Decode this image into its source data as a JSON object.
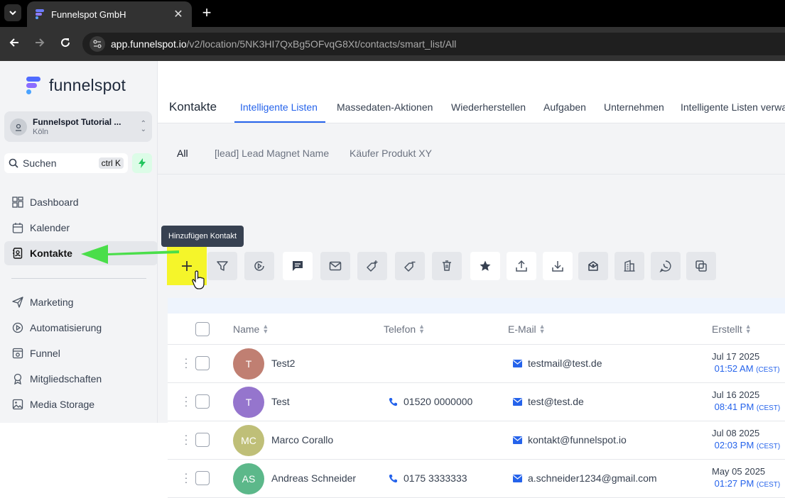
{
  "browser": {
    "tab_title": "Funnelspot GmbH",
    "url_host": "app.funnelspot.io",
    "url_path": "/v2/location/5NK3HI7QxBg5OFvqG8Xt/contacts/smart_list/All"
  },
  "sidebar": {
    "logo_text": "funnelspot",
    "account_name": "Funnelspot Tutorial ...",
    "account_location": "Köln",
    "search_label": "Suchen",
    "search_shortcut": "ctrl K",
    "items": [
      {
        "label": "Dashboard",
        "icon": "dashboard-icon"
      },
      {
        "label": "Kalender",
        "icon": "calendar-icon"
      },
      {
        "label": "Kontakte",
        "icon": "contacts-icon",
        "active": true
      },
      {
        "label": "Marketing",
        "icon": "send-icon"
      },
      {
        "label": "Automatisierung",
        "icon": "automation-icon"
      },
      {
        "label": "Funnel",
        "icon": "funnel-page-icon"
      },
      {
        "label": "Mitgliedschaften",
        "icon": "membership-icon"
      },
      {
        "label": "Media Storage",
        "icon": "image-icon"
      }
    ]
  },
  "header": {
    "title": "Kontakte",
    "tabs": [
      {
        "label": "Intelligente Listen",
        "active": true
      },
      {
        "label": "Massedaten-Aktionen"
      },
      {
        "label": "Wiederherstellen"
      },
      {
        "label": "Aufgaben"
      },
      {
        "label": "Unternehmen"
      },
      {
        "label": "Intelligente Listen verwa"
      }
    ]
  },
  "smart_lists": {
    "tabs": [
      "All",
      "[lead] Lead Magnet Name",
      "Käufer Produkt XY"
    ]
  },
  "toolbar": {
    "tooltip": "Hinzufügen Kontakt",
    "actions": [
      "add",
      "filter",
      "automation",
      "sms",
      "email",
      "add-tag",
      "remove-tag",
      "delete",
      "review",
      "export",
      "import",
      "mail-open",
      "company",
      "whatsapp",
      "merge"
    ]
  },
  "table": {
    "columns": [
      "Name",
      "Telefon",
      "E-Mail",
      "Erstellt"
    ],
    "rows": [
      {
        "initials": "T",
        "avatar_color": "#c07f72",
        "name": "Test2",
        "phone": "",
        "email": "testmail@test.de",
        "date": "Jul 17 2025",
        "time": "01:52 AM",
        "tz": "(CEST)"
      },
      {
        "initials": "T",
        "avatar_color": "#9575cd",
        "name": "Test",
        "phone": "01520 0000000",
        "email": "test@test.de",
        "date": "Jul 16 2025",
        "time": "08:41 PM",
        "tz": "(CEST)"
      },
      {
        "initials": "MC",
        "avatar_color": "#bfbf78",
        "name": "Marco Corallo",
        "phone": "",
        "email": "kontakt@funnelspot.io",
        "date": "Jul 08 2025",
        "time": "02:03 PM",
        "tz": "(CEST)"
      },
      {
        "initials": "AS",
        "avatar_color": "#5cb88a",
        "name": "Andreas Schneider",
        "phone": "0175 3333333",
        "email": "a.schneider1234@gmail.com",
        "date": "May 05 2025",
        "time": "01:27 PM",
        "tz": "(CEST)"
      }
    ]
  },
  "colors": {
    "accent": "#2563eb",
    "highlight": "#f5f52a",
    "arrow": "#4ade4a"
  }
}
